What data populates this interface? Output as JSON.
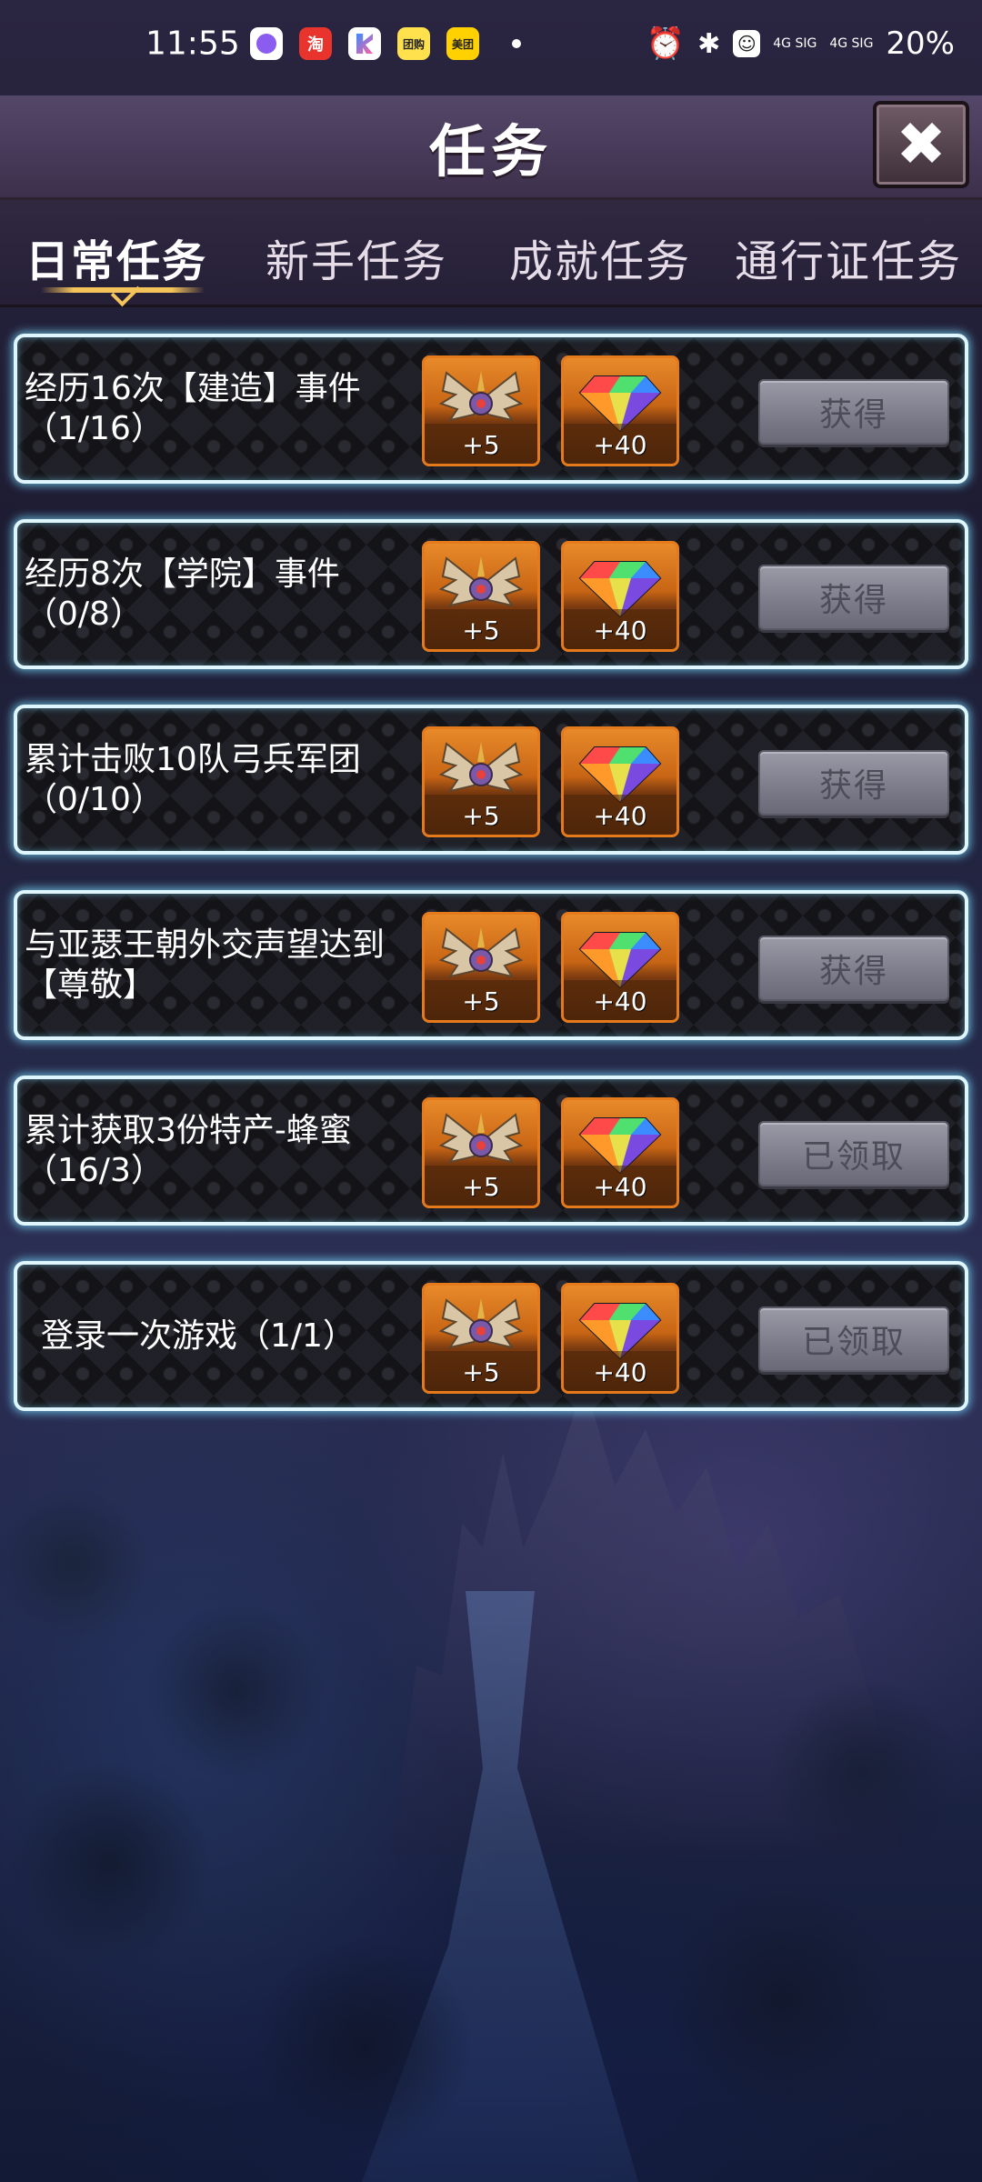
{
  "status_bar": {
    "time": "11:55",
    "network_1": "4G SIG",
    "network_2": "4G SIG",
    "battery": "20%",
    "apps": [
      "淘",
      "团购",
      "美团"
    ]
  },
  "header": {
    "title": "任务",
    "close_label": "✖"
  },
  "tabs": [
    {
      "label": "日常任务",
      "active": true
    },
    {
      "label": "新手任务",
      "active": false
    },
    {
      "label": "成就任务",
      "active": false
    },
    {
      "label": "通行证任务",
      "active": false
    }
  ],
  "tasks": [
    {
      "title": "经历16次【建造】事件",
      "progress": "（1/16）",
      "reward_1": "+5",
      "reward_2": "+40",
      "button": "获得"
    },
    {
      "title": "经历8次【学院】事件",
      "progress": "（0/8）",
      "reward_1": "+5",
      "reward_2": "+40",
      "button": "获得"
    },
    {
      "title": "累计击败10队弓兵军团",
      "progress": "（0/10）",
      "reward_1": "+5",
      "reward_2": "+40",
      "button": "获得"
    },
    {
      "title": "与亚瑟王朝外交声望达到【尊敬】",
      "progress": "",
      "reward_1": "+5",
      "reward_2": "+40",
      "button": "获得"
    },
    {
      "title": "累计获取3份特产-蜂蜜",
      "progress": "（16/3）",
      "reward_1": "+5",
      "reward_2": "+40",
      "button": "已领取"
    },
    {
      "title": "登录一次游戏（1/1）",
      "progress": "",
      "reward_1": "+5",
      "reward_2": "+40",
      "button": "已领取"
    }
  ],
  "icons": {
    "reward_1": "winged-emblem-icon",
    "reward_2": "rainbow-gem-icon"
  }
}
